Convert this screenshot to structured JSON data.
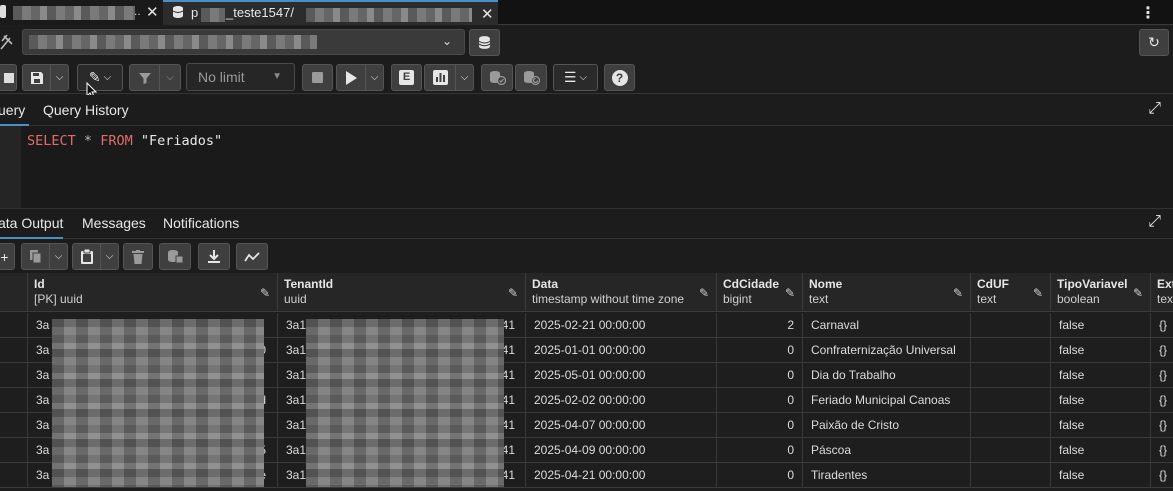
{
  "tabs": [
    {
      "label": "",
      "close": "✕"
    },
    {
      "label_prefix": "p",
      "label_mid": "_teste1547/",
      "close": "✕"
    }
  ],
  "menu_icon": "⋮",
  "toolbar": {
    "limit_label": "No limit",
    "explain_label": "E"
  },
  "query_tabs": [
    "uery",
    "Query History"
  ],
  "editor": {
    "kw_select": "SELECT",
    "star": "*",
    "kw_from": "FROM",
    "table": "\"Feriados\""
  },
  "output_tabs": [
    "ata Output",
    "Messages",
    "Notifications"
  ],
  "columns": [
    {
      "name": "Id",
      "type": "[PK] uuid"
    },
    {
      "name": "TenantId",
      "type": "uuid"
    },
    {
      "name": "Data",
      "type": "timestamp without time zone"
    },
    {
      "name": "CdCidade",
      "type": "bigint"
    },
    {
      "name": "Nome",
      "type": "text"
    },
    {
      "name": "CdUF",
      "type": "text"
    },
    {
      "name": "TipoVariavel",
      "type": "boolean"
    },
    {
      "name": "Ext",
      "type": "tex"
    }
  ],
  "rows": [
    {
      "id": "3a",
      "id_tail": "",
      "tenant": "3a1",
      "tenant_tail": "41",
      "data": "2025-02-21 00:00:00",
      "cd_cidade": "2",
      "nome": "Carnaval",
      "cd_uf": "",
      "tipo": "false",
      "ext": "{}"
    },
    {
      "id": "3a",
      "id_tail": "0",
      "tenant": "3a1",
      "tenant_tail": "41",
      "data": "2025-01-01 00:00:00",
      "cd_cidade": "0",
      "nome": "Confraternização Universal",
      "cd_uf": "",
      "tipo": "false",
      "ext": "{}"
    },
    {
      "id": "3a",
      "id_tail": "",
      "tenant": "3a1",
      "tenant_tail": "41",
      "data": "2025-05-01 00:00:00",
      "cd_cidade": "0",
      "nome": "Dia do Trabalho",
      "cd_uf": "",
      "tipo": "false",
      "ext": "{}"
    },
    {
      "id": "3a",
      "id_tail": "d",
      "tenant": "3a1",
      "tenant_tail": "41",
      "data": "2025-02-02 00:00:00",
      "cd_cidade": "0",
      "nome": "Feriado Municipal Canoas",
      "cd_uf": "",
      "tipo": "false",
      "ext": "{}"
    },
    {
      "id": "3a",
      "id_tail": "",
      "tenant": "3a1",
      "tenant_tail": "41",
      "data": "2025-04-07 00:00:00",
      "cd_cidade": "0",
      "nome": "Paixão de Cristo",
      "cd_uf": "",
      "tipo": "false",
      "ext": "{}"
    },
    {
      "id": "3a",
      "id_tail": "5",
      "tenant": "3a1",
      "tenant_tail": "41",
      "data": "2025-04-09 00:00:00",
      "cd_cidade": "0",
      "nome": "Páscoa",
      "cd_uf": "",
      "tipo": "false",
      "ext": "{}"
    },
    {
      "id": "3a",
      "id_tail": "e",
      "tenant": "3a1",
      "tenant_tail": "41",
      "data": "2025-04-21 00:00:00",
      "cd_cidade": "0",
      "nome": "Tiradentes",
      "cd_uf": "",
      "tipo": "false",
      "ext": "{}"
    }
  ]
}
